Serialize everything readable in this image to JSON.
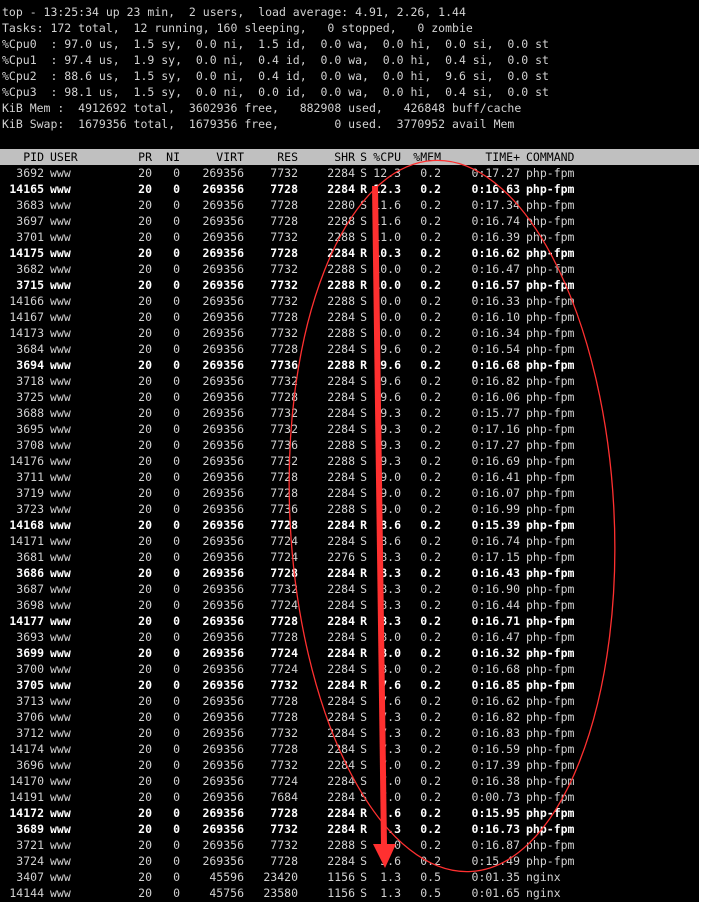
{
  "summary": [
    "top - 13:25:34 up 23 min,  2 users,  load average: 4.91, 2.26, 1.44",
    "Tasks: 172 total,  12 running, 160 sleeping,   0 stopped,   0 zombie",
    "%Cpu0  : 97.0 us,  1.5 sy,  0.0 ni,  1.5 id,  0.0 wa,  0.0 hi,  0.0 si,  0.0 st",
    "%Cpu1  : 97.4 us,  1.9 sy,  0.0 ni,  0.4 id,  0.0 wa,  0.0 hi,  0.4 si,  0.0 st",
    "%Cpu2  : 88.6 us,  1.5 sy,  0.0 ni,  0.4 id,  0.0 wa,  0.0 hi,  9.6 si,  0.0 st",
    "%Cpu3  : 98.1 us,  1.5 sy,  0.0 ni,  0.0 id,  0.0 wa,  0.0 hi,  0.4 si,  0.0 st",
    "KiB Mem :  4912692 total,  3602936 free,   882908 used,   426848 buff/cache",
    "KiB Swap:  1679356 total,  1679356 free,        0 used.  3770952 avail Mem"
  ],
  "columns": [
    "PID",
    "USER",
    "PR",
    "NI",
    "VIRT",
    "RES",
    "SHR",
    "S",
    "%CPU",
    "%MEM",
    "TIME+",
    "COMMAND"
  ],
  "processes": [
    [
      "3692",
      "www",
      "20",
      "0",
      "269356",
      "7732",
      "2284",
      "S",
      "12.3",
      "0.2",
      "0:17.27",
      "php-fpm"
    ],
    [
      "14165",
      "www",
      "20",
      "0",
      "269356",
      "7728",
      "2284",
      "R",
      "12.3",
      "0.2",
      "0:16.63",
      "php-fpm"
    ],
    [
      "3683",
      "www",
      "20",
      "0",
      "269356",
      "7728",
      "2280",
      "S",
      "11.6",
      "0.2",
      "0:17.34",
      "php-fpm"
    ],
    [
      "3697",
      "www",
      "20",
      "0",
      "269356",
      "7728",
      "2288",
      "S",
      "11.6",
      "0.2",
      "0:16.74",
      "php-fpm"
    ],
    [
      "3701",
      "www",
      "20",
      "0",
      "269356",
      "7732",
      "2288",
      "S",
      "11.0",
      "0.2",
      "0:16.39",
      "php-fpm"
    ],
    [
      "14175",
      "www",
      "20",
      "0",
      "269356",
      "7728",
      "2284",
      "R",
      "10.3",
      "0.2",
      "0:16.62",
      "php-fpm"
    ],
    [
      "3682",
      "www",
      "20",
      "0",
      "269356",
      "7732",
      "2288",
      "S",
      "10.0",
      "0.2",
      "0:16.47",
      "php-fpm"
    ],
    [
      "3715",
      "www",
      "20",
      "0",
      "269356",
      "7732",
      "2288",
      "R",
      "10.0",
      "0.2",
      "0:16.57",
      "php-fpm"
    ],
    [
      "14166",
      "www",
      "20",
      "0",
      "269356",
      "7732",
      "2288",
      "S",
      "10.0",
      "0.2",
      "0:16.33",
      "php-fpm"
    ],
    [
      "14167",
      "www",
      "20",
      "0",
      "269356",
      "7728",
      "2284",
      "S",
      "10.0",
      "0.2",
      "0:16.10",
      "php-fpm"
    ],
    [
      "14173",
      "www",
      "20",
      "0",
      "269356",
      "7732",
      "2288",
      "S",
      "10.0",
      "0.2",
      "0:16.34",
      "php-fpm"
    ],
    [
      "3684",
      "www",
      "20",
      "0",
      "269356",
      "7728",
      "2284",
      "S",
      "9.6",
      "0.2",
      "0:16.54",
      "php-fpm"
    ],
    [
      "3694",
      "www",
      "20",
      "0",
      "269356",
      "7736",
      "2288",
      "R",
      "9.6",
      "0.2",
      "0:16.68",
      "php-fpm"
    ],
    [
      "3718",
      "www",
      "20",
      "0",
      "269356",
      "7732",
      "2284",
      "S",
      "9.6",
      "0.2",
      "0:16.82",
      "php-fpm"
    ],
    [
      "3725",
      "www",
      "20",
      "0",
      "269356",
      "7728",
      "2284",
      "S",
      "9.6",
      "0.2",
      "0:16.06",
      "php-fpm"
    ],
    [
      "3688",
      "www",
      "20",
      "0",
      "269356",
      "7732",
      "2284",
      "S",
      "9.3",
      "0.2",
      "0:15.77",
      "php-fpm"
    ],
    [
      "3695",
      "www",
      "20",
      "0",
      "269356",
      "7732",
      "2284",
      "S",
      "9.3",
      "0.2",
      "0:17.16",
      "php-fpm"
    ],
    [
      "3708",
      "www",
      "20",
      "0",
      "269356",
      "7736",
      "2288",
      "S",
      "9.3",
      "0.2",
      "0:17.27",
      "php-fpm"
    ],
    [
      "14176",
      "www",
      "20",
      "0",
      "269356",
      "7732",
      "2288",
      "S",
      "9.3",
      "0.2",
      "0:16.69",
      "php-fpm"
    ],
    [
      "3711",
      "www",
      "20",
      "0",
      "269356",
      "7728",
      "2284",
      "S",
      "9.0",
      "0.2",
      "0:16.41",
      "php-fpm"
    ],
    [
      "3719",
      "www",
      "20",
      "0",
      "269356",
      "7728",
      "2284",
      "S",
      "9.0",
      "0.2",
      "0:16.07",
      "php-fpm"
    ],
    [
      "3723",
      "www",
      "20",
      "0",
      "269356",
      "7736",
      "2288",
      "S",
      "9.0",
      "0.2",
      "0:16.99",
      "php-fpm"
    ],
    [
      "14168",
      "www",
      "20",
      "0",
      "269356",
      "7728",
      "2284",
      "R",
      "8.6",
      "0.2",
      "0:15.39",
      "php-fpm"
    ],
    [
      "14171",
      "www",
      "20",
      "0",
      "269356",
      "7724",
      "2284",
      "S",
      "8.6",
      "0.2",
      "0:16.74",
      "php-fpm"
    ],
    [
      "3681",
      "www",
      "20",
      "0",
      "269356",
      "7724",
      "2276",
      "S",
      "8.3",
      "0.2",
      "0:17.15",
      "php-fpm"
    ],
    [
      "3686",
      "www",
      "20",
      "0",
      "269356",
      "7728",
      "2284",
      "R",
      "8.3",
      "0.2",
      "0:16.43",
      "php-fpm"
    ],
    [
      "3687",
      "www",
      "20",
      "0",
      "269356",
      "7732",
      "2284",
      "S",
      "8.3",
      "0.2",
      "0:16.90",
      "php-fpm"
    ],
    [
      "3698",
      "www",
      "20",
      "0",
      "269356",
      "7724",
      "2284",
      "S",
      "8.3",
      "0.2",
      "0:16.44",
      "php-fpm"
    ],
    [
      "14177",
      "www",
      "20",
      "0",
      "269356",
      "7728",
      "2284",
      "R",
      "8.3",
      "0.2",
      "0:16.71",
      "php-fpm"
    ],
    [
      "3693",
      "www",
      "20",
      "0",
      "269356",
      "7728",
      "2284",
      "S",
      "8.0",
      "0.2",
      "0:16.47",
      "php-fpm"
    ],
    [
      "3699",
      "www",
      "20",
      "0",
      "269356",
      "7724",
      "2284",
      "R",
      "8.0",
      "0.2",
      "0:16.32",
      "php-fpm"
    ],
    [
      "3700",
      "www",
      "20",
      "0",
      "269356",
      "7724",
      "2284",
      "S",
      "8.0",
      "0.2",
      "0:16.68",
      "php-fpm"
    ],
    [
      "3705",
      "www",
      "20",
      "0",
      "269356",
      "7732",
      "2284",
      "R",
      "7.6",
      "0.2",
      "0:16.85",
      "php-fpm"
    ],
    [
      "3713",
      "www",
      "20",
      "0",
      "269356",
      "7728",
      "2284",
      "S",
      "7.6",
      "0.2",
      "0:16.62",
      "php-fpm"
    ],
    [
      "3706",
      "www",
      "20",
      "0",
      "269356",
      "7728",
      "2284",
      "S",
      "7.3",
      "0.2",
      "0:16.82",
      "php-fpm"
    ],
    [
      "3712",
      "www",
      "20",
      "0",
      "269356",
      "7732",
      "2284",
      "S",
      "7.3",
      "0.2",
      "0:16.83",
      "php-fpm"
    ],
    [
      "14174",
      "www",
      "20",
      "0",
      "269356",
      "7728",
      "2284",
      "S",
      "7.3",
      "0.2",
      "0:16.59",
      "php-fpm"
    ],
    [
      "3696",
      "www",
      "20",
      "0",
      "269356",
      "7732",
      "2284",
      "S",
      "7.0",
      "0.2",
      "0:17.39",
      "php-fpm"
    ],
    [
      "14170",
      "www",
      "20",
      "0",
      "269356",
      "7724",
      "2284",
      "S",
      "7.0",
      "0.2",
      "0:16.38",
      "php-fpm"
    ],
    [
      "14191",
      "www",
      "20",
      "0",
      "269356",
      "7684",
      "2284",
      "S",
      "7.0",
      "0.2",
      "0:00.73",
      "php-fpm"
    ],
    [
      "14172",
      "www",
      "20",
      "0",
      "269356",
      "7728",
      "2284",
      "R",
      "6.6",
      "0.2",
      "0:15.95",
      "php-fpm"
    ],
    [
      "3689",
      "www",
      "20",
      "0",
      "269356",
      "7732",
      "2284",
      "R",
      "6.3",
      "0.2",
      "0:16.73",
      "php-fpm"
    ],
    [
      "3721",
      "www",
      "20",
      "0",
      "269356",
      "7732",
      "2288",
      "S",
      "6.0",
      "0.2",
      "0:16.87",
      "php-fpm"
    ],
    [
      "3724",
      "www",
      "20",
      "0",
      "269356",
      "7728",
      "2284",
      "S",
      "5.6",
      "0.2",
      "0:15.49",
      "php-fpm"
    ],
    [
      "3407",
      "www",
      "20",
      "0",
      "45596",
      "23420",
      "1156",
      "S",
      "1.3",
      "0.5",
      "0:01.35",
      "nginx"
    ],
    [
      "14144",
      "www",
      "20",
      "0",
      "45756",
      "23580",
      "1156",
      "S",
      "1.3",
      "0.5",
      "0:01.65",
      "nginx"
    ]
  ],
  "colors": {
    "terminal_bg": "#000000",
    "text": "#d2d2d2",
    "running_text": "#ffffff",
    "header_bg": "#c0c0c0",
    "annotation": "#ff3030"
  }
}
